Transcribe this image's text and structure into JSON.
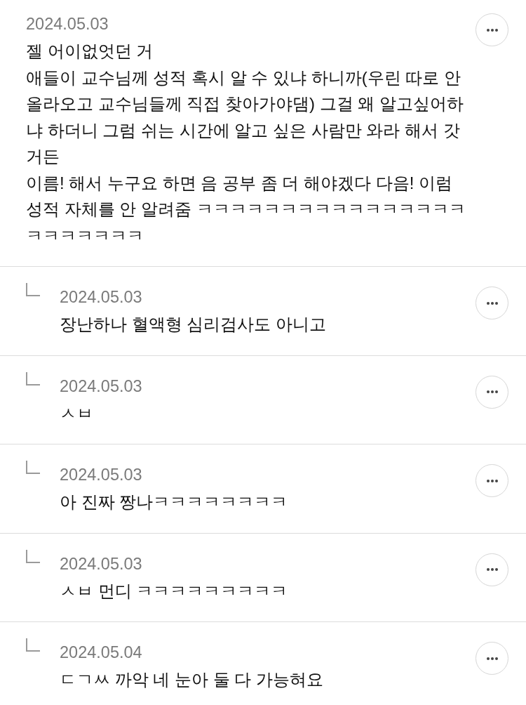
{
  "comments": [
    {
      "kind": "comment",
      "date": "2024.05.03",
      "paragraphs": [
        "젤 어이없엇던 거",
        "애들이 교수님께 성적 혹시 알 수 있냐 하니까(우린 따로 안 올라오고 교수님들께 직접 찾아가야댐) 그걸 왜 알고싶어하냐 하더니 그럼 쉬는 시간에 알고 싶은 사람만 와라 해서 갓거든",
        "이름! 해서 누구요 하면 음 공부 좀 더 해야겠다 다음! 이럼 성적 자체를 안 알려줌 ㅋㅋㅋㅋㅋㅋㅋㅋㅋㅋㅋㅋㅋㅋㅋㅋㅋㅋㅋㅋㅋㅋㅋ"
      ]
    },
    {
      "kind": "reply",
      "date": "2024.05.03",
      "paragraphs": [
        "장난하나 혈액형 심리검사도 아니고"
      ]
    },
    {
      "kind": "reply",
      "date": "2024.05.03",
      "paragraphs": [
        "ㅅㅂ"
      ]
    },
    {
      "kind": "reply",
      "date": "2024.05.03",
      "paragraphs": [
        "아 진짜 짱나ㅋㅋㅋㅋㅋㅋㅋㅋ"
      ]
    },
    {
      "kind": "reply",
      "date": "2024.05.03",
      "paragraphs": [
        "ㅅㅂ 먼디 ㅋㅋㅋㅋㅋㅋㅋㅋㅋ"
      ]
    },
    {
      "kind": "reply",
      "date": "2024.05.04",
      "paragraphs": [
        "ㄷㄱㅆ 까악 네 눈아 둘 다 가능혀요"
      ]
    }
  ]
}
